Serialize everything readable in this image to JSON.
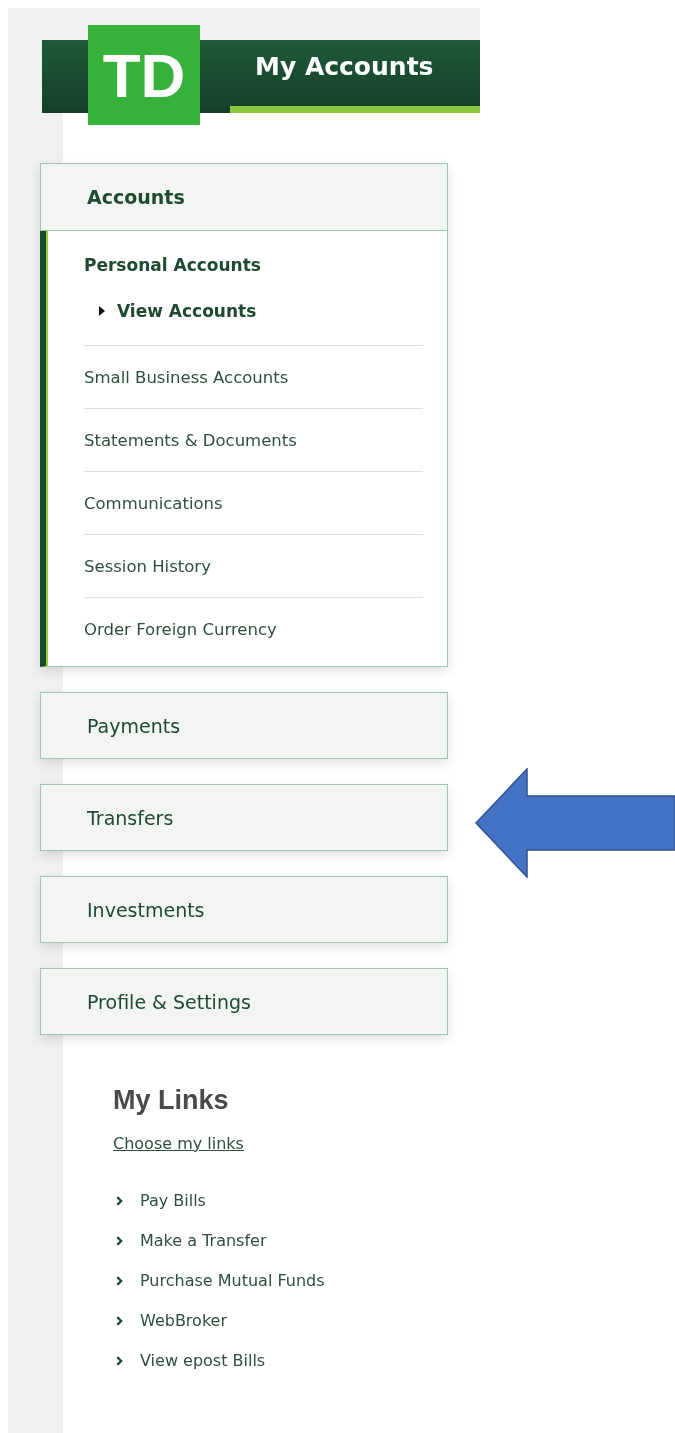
{
  "header": {
    "logo": "TD",
    "title": "My Accounts"
  },
  "nav": [
    {
      "label": "Accounts",
      "expanded": true,
      "items": [
        {
          "kind": "group",
          "label": "Personal Accounts",
          "children": [
            {
              "label": "View Accounts",
              "selected": true
            }
          ]
        },
        {
          "kind": "link",
          "label": "Small Business Accounts",
          "selected": false
        },
        {
          "kind": "link",
          "label": "Statements & Documents",
          "selected": false
        },
        {
          "kind": "link",
          "label": "Communications",
          "selected": false
        },
        {
          "kind": "link",
          "label": "Session History",
          "selected": false
        },
        {
          "kind": "link",
          "label": "Order Foreign Currency",
          "selected": false
        }
      ]
    },
    {
      "label": "Payments",
      "expanded": false
    },
    {
      "label": "Transfers",
      "expanded": false
    },
    {
      "label": "Investments",
      "expanded": false
    },
    {
      "label": "Profile & Settings",
      "expanded": false
    }
  ],
  "my_links": {
    "title": "My Links",
    "choose_link": "Choose my links",
    "links": [
      "Pay Bills",
      "Make a Transfer",
      "Purchase Mutual Funds",
      "WebBroker",
      "View epost Bills"
    ]
  }
}
